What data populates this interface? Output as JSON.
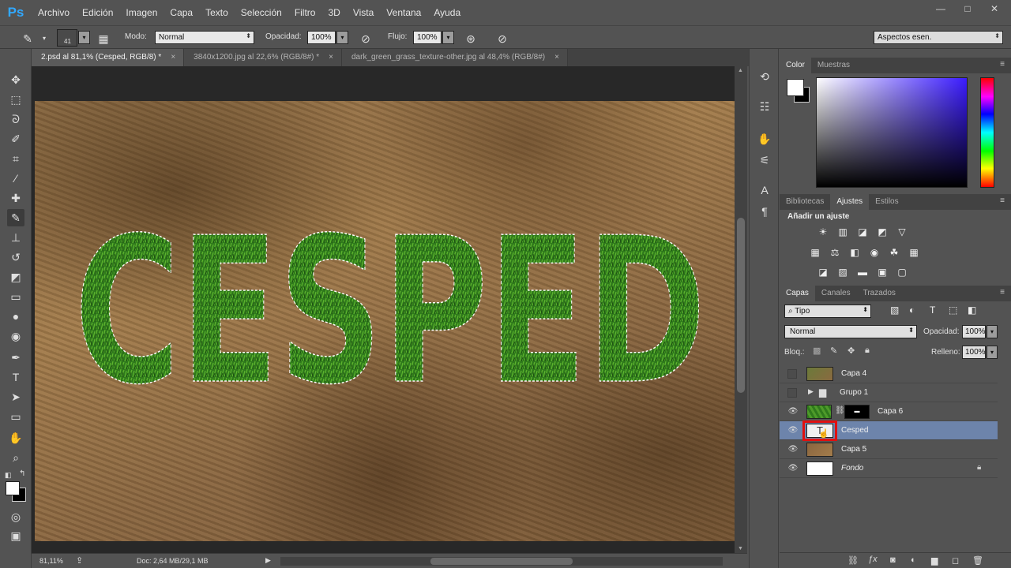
{
  "app": {
    "logo": "Ps"
  },
  "menu": [
    "Archivo",
    "Edición",
    "Imagen",
    "Capa",
    "Texto",
    "Selección",
    "Filtro",
    "3D",
    "Vista",
    "Ventana",
    "Ayuda"
  ],
  "window_buttons": {
    "minimize": "—",
    "maximize": "□",
    "close": "✕"
  },
  "options": {
    "brush_size": "41",
    "mode_label": "Modo:",
    "mode_value": "Normal",
    "opacity_label": "Opacidad:",
    "opacity_value": "100%",
    "flow_label": "Flujo:",
    "flow_value": "100%",
    "workspace": "Aspectos esen."
  },
  "tabs": [
    {
      "label": "2.psd al 81,1% (Cesped, RGB/8) *",
      "close": "×"
    },
    {
      "label": "3840x1200.jpg al 22,6% (RGB/8#) *",
      "close": "×"
    },
    {
      "label": "dark_green_grass_texture-other.jpg al 48,4% (RGB/8#)",
      "close": "×"
    }
  ],
  "canvas": {
    "text": "CESPED"
  },
  "status": {
    "zoom": "81,11%",
    "doc": "Doc: 2,64 MB/29,1 MB"
  },
  "color_panel": {
    "tabs": [
      "Color",
      "Muestras"
    ]
  },
  "adjust_panel": {
    "tabs": [
      "Bibliotecas",
      "Ajustes",
      "Estilos"
    ],
    "title": "Añadir un ajuste"
  },
  "layers_panel": {
    "tabs": [
      "Capas",
      "Canales",
      "Trazados"
    ],
    "filter": "Tipo",
    "blend": "Normal",
    "opacity_label": "Opacidad:",
    "opacity_value": "100%",
    "lock_label": "Bloq.:",
    "fill_label": "Relleno:",
    "fill_value": "100%",
    "layers": [
      {
        "name": "Capa 4",
        "visible": false
      },
      {
        "name": "Grupo 1",
        "visible": false
      },
      {
        "name": "Capa 6",
        "visible": true
      },
      {
        "name": "Cesped",
        "visible": true,
        "selected": true
      },
      {
        "name": "Capa 5",
        "visible": true
      },
      {
        "name": "Fondo",
        "visible": true,
        "locked": true
      }
    ]
  },
  "colors": {
    "accent": "#31a8ff",
    "selected_layer": "#6d84ab",
    "highlight_box": "#e01010"
  }
}
